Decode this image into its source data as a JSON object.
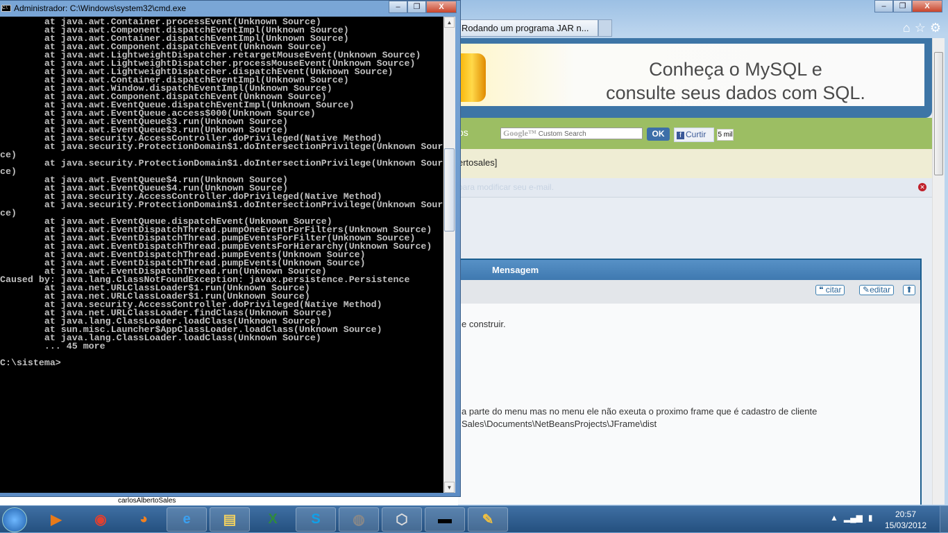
{
  "browser": {
    "tab_title": "Rodando um programa JAR n...",
    "banner": {
      "line1": "Conheça o MySQL e",
      "line2": "consulte seus dados com SQL."
    },
    "search": {
      "brand": "Google™",
      "placeholder": "Custom Search",
      "ok_label": "OK"
    },
    "facebook": {
      "like_label": "Curtir",
      "count": "5 mil"
    },
    "nav_fragment": "os",
    "user_fragment": "ertosales]",
    "notice": "para modificar seu e-mail.",
    "post": {
      "header": "Mensagem",
      "quote_label": "citar",
      "edit_label": "editar",
      "lines": [
        "e construir.",
        "a parte do menu mas no menu ele não exeuta o proximo frame que é cadastro de cliente",
        "Sales\\Documents\\NetBeansProjects\\JFrame\\dist"
      ]
    },
    "status_text": "carlosAlbertoSales"
  },
  "cmd": {
    "title": "Administrador: C:\\Windows\\system32\\cmd.exe",
    "lines": [
      "        at java.awt.Container.processEvent(Unknown Source)",
      "        at java.awt.Component.dispatchEventImpl(Unknown Source)",
      "        at java.awt.Container.dispatchEventImpl(Unknown Source)",
      "        at java.awt.Component.dispatchEvent(Unknown Source)",
      "        at java.awt.LightweightDispatcher.retargetMouseEvent(Unknown Source)",
      "        at java.awt.LightweightDispatcher.processMouseEvent(Unknown Source)",
      "        at java.awt.LightweightDispatcher.dispatchEvent(Unknown Source)",
      "        at java.awt.Container.dispatchEventImpl(Unknown Source)",
      "        at java.awt.Window.dispatchEventImpl(Unknown Source)",
      "        at java.awt.Component.dispatchEvent(Unknown Source)",
      "        at java.awt.EventQueue.dispatchEventImpl(Unknown Source)",
      "        at java.awt.EventQueue.access$000(Unknown Source)",
      "        at java.awt.EventQueue$3.run(Unknown Source)",
      "        at java.awt.EventQueue$3.run(Unknown Source)",
      "        at java.security.AccessController.doPrivileged(Native Method)",
      "        at java.security.ProtectionDomain$1.doIntersectionPrivilege(Unknown Sour",
      "ce)",
      "        at java.security.ProtectionDomain$1.doIntersectionPrivilege(Unknown Sour",
      "ce)",
      "        at java.awt.EventQueue$4.run(Unknown Source)",
      "        at java.awt.EventQueue$4.run(Unknown Source)",
      "        at java.security.AccessController.doPrivileged(Native Method)",
      "        at java.security.ProtectionDomain$1.doIntersectionPrivilege(Unknown Sour",
      "ce)",
      "        at java.awt.EventQueue.dispatchEvent(Unknown Source)",
      "        at java.awt.EventDispatchThread.pumpOneEventForFilters(Unknown Source)",
      "        at java.awt.EventDispatchThread.pumpEventsForFilter(Unknown Source)",
      "        at java.awt.EventDispatchThread.pumpEventsForHierarchy(Unknown Source)",
      "        at java.awt.EventDispatchThread.pumpEvents(Unknown Source)",
      "        at java.awt.EventDispatchThread.pumpEvents(Unknown Source)",
      "        at java.awt.EventDispatchThread.run(Unknown Source)",
      "Caused by: java.lang.ClassNotFoundException: javax.persistence.Persistence",
      "        at java.net.URLClassLoader$1.run(Unknown Source)",
      "        at java.net.URLClassLoader$1.run(Unknown Source)",
      "        at java.security.AccessController.doPrivileged(Native Method)",
      "        at java.net.URLClassLoader.findClass(Unknown Source)",
      "        at java.lang.ClassLoader.loadClass(Unknown Source)",
      "        at sun.misc.Launcher$AppClassLoader.loadClass(Unknown Source)",
      "        at java.lang.ClassLoader.loadClass(Unknown Source)",
      "        ... 45 more",
      "",
      "C:\\sistema>"
    ]
  },
  "taskbar": {
    "apps": [
      "media-player",
      "chrome",
      "firefox",
      "internet-explorer",
      "file-explorer",
      "excel",
      "skype",
      "netbeans",
      "virtualbox",
      "cmd",
      "paint"
    ],
    "time": "20:57",
    "date": "15/03/2012"
  }
}
